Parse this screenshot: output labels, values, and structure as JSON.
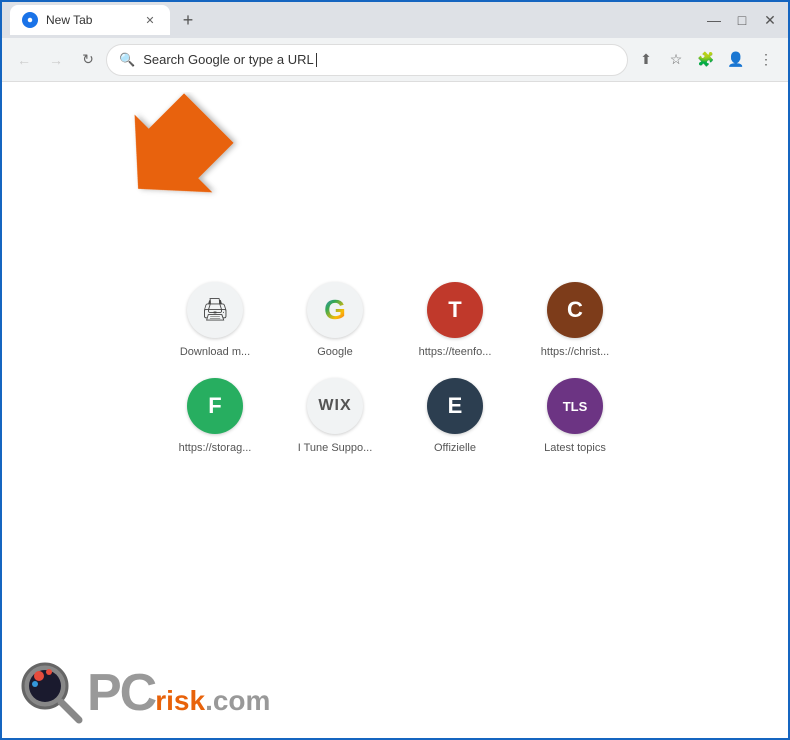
{
  "browser": {
    "tab_title": "New Tab",
    "new_tab_btn": "+",
    "address_placeholder": "Search Google or type a URL",
    "window_controls": [
      "—",
      "□",
      "✕"
    ]
  },
  "nav": {
    "back": "←",
    "forward": "→",
    "refresh": "↻",
    "address_text": "Search Google or type a URL"
  },
  "shortcuts": [
    {
      "label": "Download m...",
      "icon_type": "download",
      "icon_char": "🖨"
    },
    {
      "label": "Google",
      "icon_type": "google",
      "icon_char": "G"
    },
    {
      "label": "https://teenfo...",
      "icon_type": "teen",
      "icon_char": "T"
    },
    {
      "label": "https://christ...",
      "icon_type": "christ",
      "icon_char": "C"
    },
    {
      "label": "https://storag...",
      "icon_type": "storage",
      "icon_char": "F"
    },
    {
      "label": "I Tune Suppo...",
      "icon_type": "wix",
      "icon_char": "WIX"
    },
    {
      "label": "Offizielle",
      "icon_type": "offizielle",
      "icon_char": "E"
    },
    {
      "label": "Latest topics",
      "icon_type": "tls",
      "icon_char": "TLS"
    }
  ],
  "logo": {
    "pc": "PC",
    "risk": "risk",
    "com": ".com"
  }
}
